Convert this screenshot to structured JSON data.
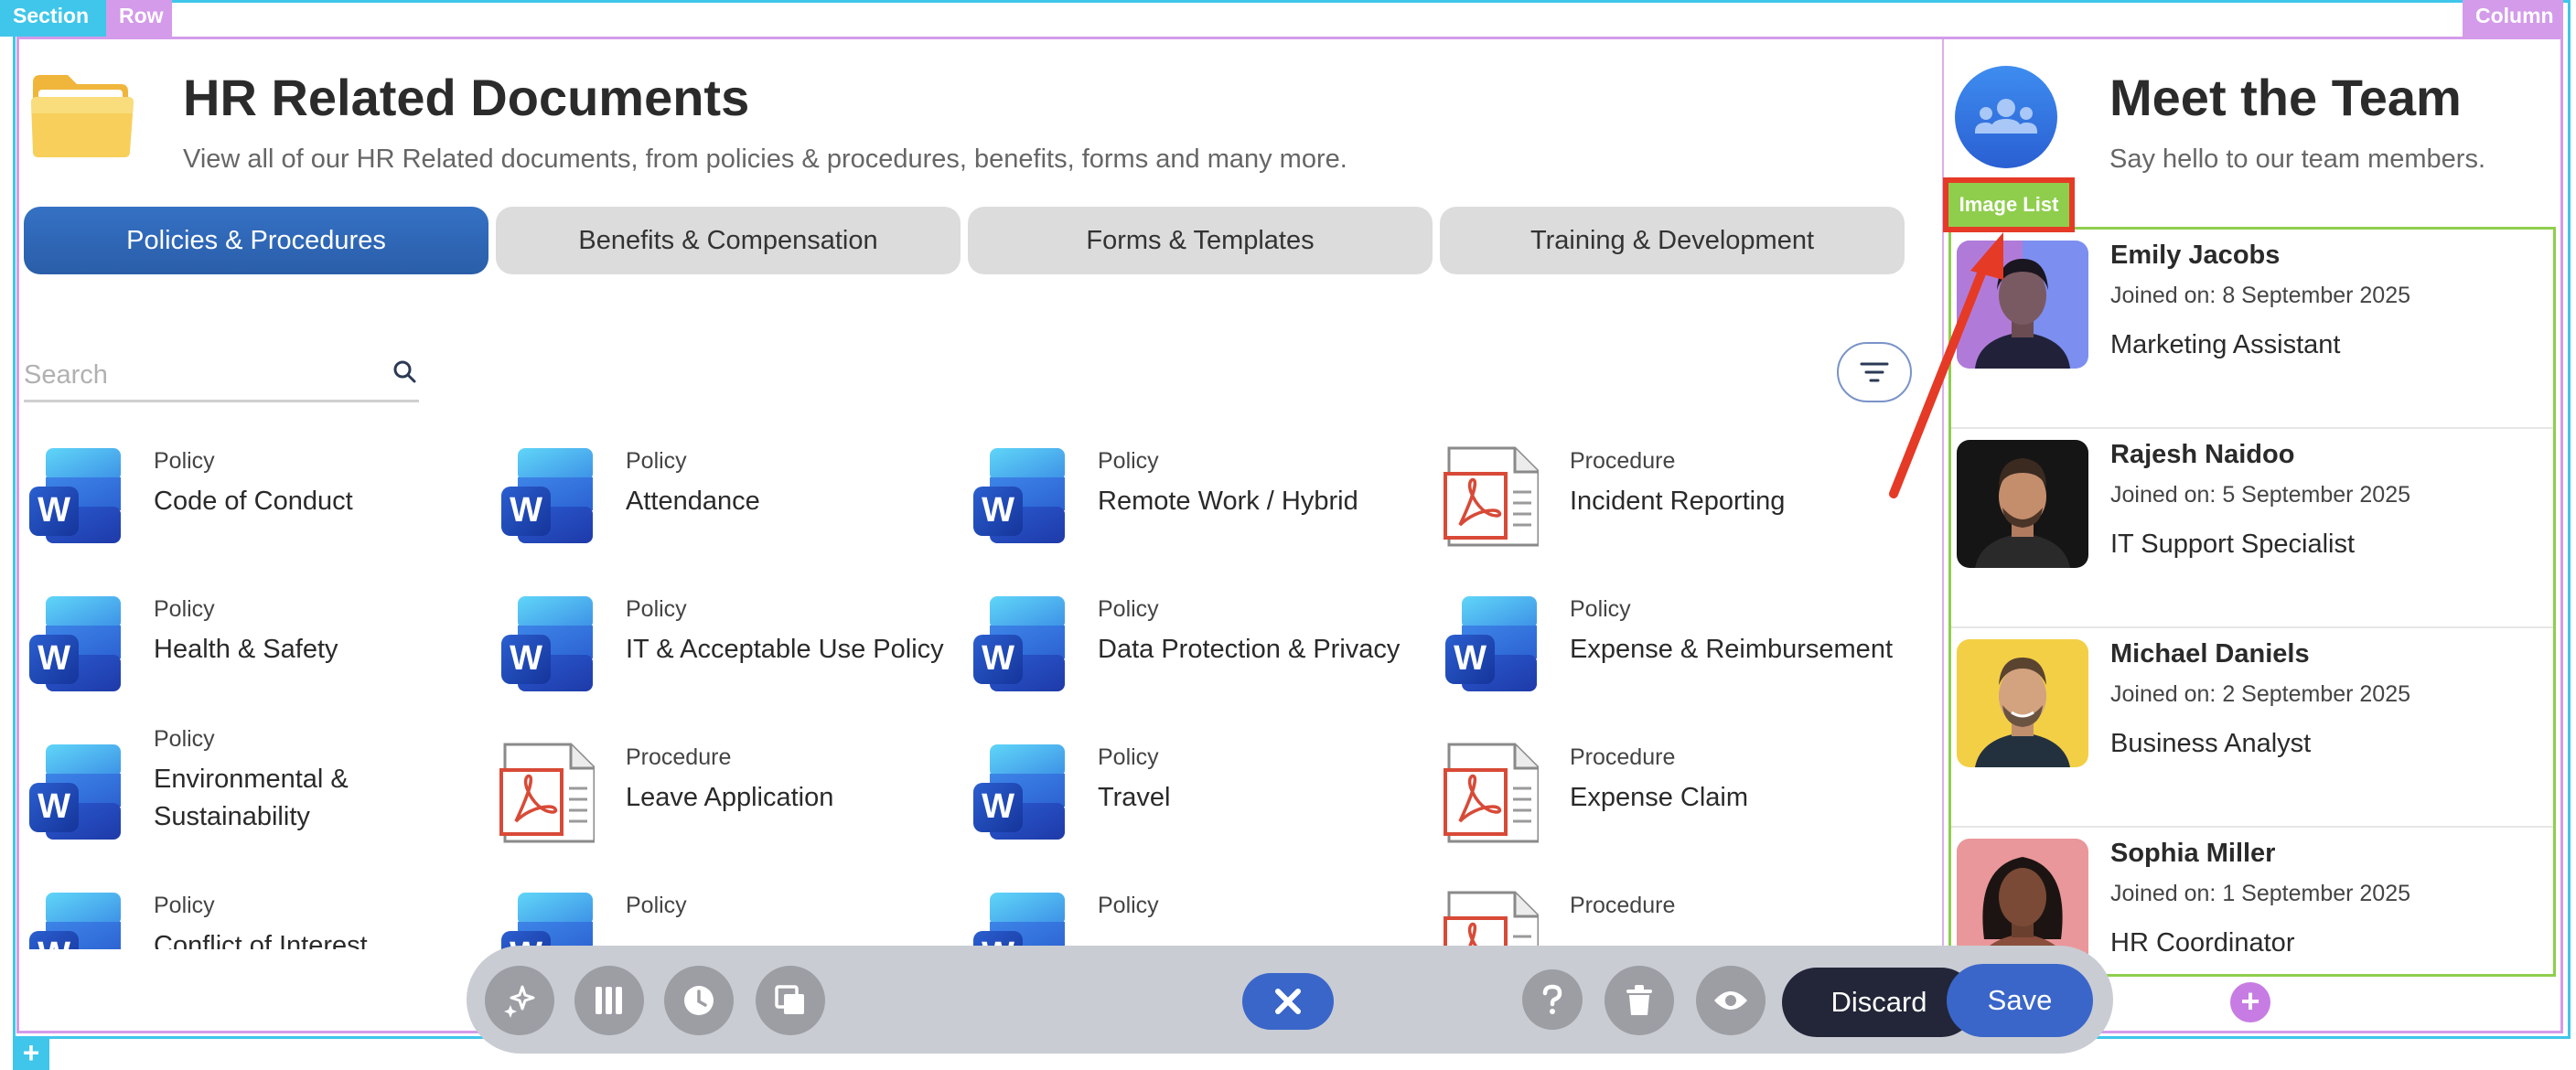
{
  "editor": {
    "section_tag": "Section",
    "row_tag": "Row",
    "column_tag": "Column",
    "element_tag": "Image List",
    "add_symbol": "+"
  },
  "hr": {
    "title": "HR Related Documents",
    "subtitle": "View all of our HR Related documents, from policies & procedures, benefits, forms and many more.",
    "icon": "folder-icon",
    "tabs": [
      {
        "label": "Policies & Procedures",
        "active": true
      },
      {
        "label": "Benefits & Compensation",
        "active": false
      },
      {
        "label": "Forms & Templates",
        "active": false
      },
      {
        "label": "Training & Development",
        "active": false
      }
    ],
    "search": {
      "placeholder": "Search",
      "value": ""
    },
    "documents": [
      {
        "type": "Policy",
        "title": "Code of Conduct",
        "icon": "word-icon"
      },
      {
        "type": "Policy",
        "title": "Attendance",
        "icon": "word-icon"
      },
      {
        "type": "Policy",
        "title": "Remote Work / Hybrid",
        "icon": "word-icon"
      },
      {
        "type": "Procedure",
        "title": "Incident Reporting",
        "icon": "pdf-icon"
      },
      {
        "type": "Policy",
        "title": "Health & Safety",
        "icon": "word-icon"
      },
      {
        "type": "Policy",
        "title": "IT & Acceptable Use Policy",
        "icon": "word-icon"
      },
      {
        "type": "Policy",
        "title": "Data Protection & Privacy",
        "icon": "word-icon"
      },
      {
        "type": "Policy",
        "title": "Expense & Reimbursement",
        "icon": "word-icon"
      },
      {
        "type": "Policy",
        "title": "Environmental & Sustainability",
        "icon": "word-icon"
      },
      {
        "type": "Procedure",
        "title": "Leave Application",
        "icon": "pdf-icon"
      },
      {
        "type": "Policy",
        "title": "Travel",
        "icon": "word-icon"
      },
      {
        "type": "Procedure",
        "title": "Expense Claim",
        "icon": "pdf-icon"
      },
      {
        "type": "Policy",
        "title": "Conflict of Interest",
        "icon": "word-icon"
      },
      {
        "type": "Policy",
        "title": "",
        "icon": "word-icon"
      },
      {
        "type": "Policy",
        "title": "",
        "icon": "word-icon"
      },
      {
        "type": "Procedure",
        "title": "",
        "icon": "pdf-icon"
      }
    ]
  },
  "team": {
    "title": "Meet the Team",
    "subtitle": "Say hello to our team members.",
    "icon": "team-group-icon",
    "members": [
      {
        "name": "Emily Jacobs",
        "joined": "Joined on: 8 September 2025",
        "role": "Marketing Assistant"
      },
      {
        "name": "Rajesh Naidoo",
        "joined": "Joined on: 5 September 2025",
        "role": "IT Support Specialist"
      },
      {
        "name": "Michael Daniels",
        "joined": "Joined on: 2 September 2025",
        "role": "Business Analyst"
      },
      {
        "name": "Sophia Miller",
        "joined": "Joined on: 1 September 2025",
        "role": "HR Coordinator"
      }
    ]
  },
  "toolbar": {
    "discard_label": "Discard",
    "save_label": "Save",
    "icons": [
      "sparkle-icon",
      "columns-icon",
      "history-icon",
      "layers-icon",
      "close-icon",
      "help-icon",
      "trash-icon",
      "eye-icon"
    ]
  },
  "colors": {
    "accent_blue": "#2a5ea9",
    "section_outline": "#3fc6ea",
    "row_outline": "#d39be9",
    "element_outline": "#8fce4d",
    "annotation_red": "#e53a26"
  }
}
